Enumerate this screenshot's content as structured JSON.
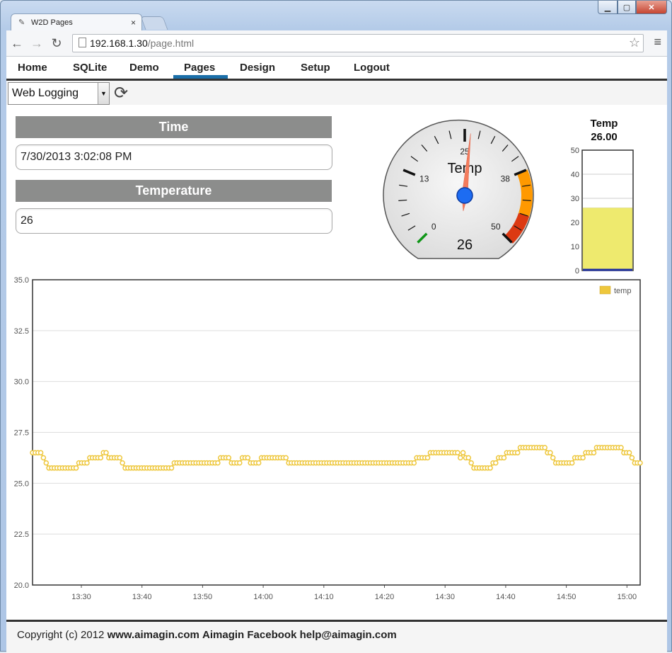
{
  "browser": {
    "tab_title": "W2D Pages",
    "tab_close": "×",
    "url_host": "192.168.1.30",
    "url_path": "/page.html",
    "icons": {
      "back": "arrow-left",
      "forward": "arrow-right",
      "reload": "reload",
      "star": "star",
      "menu": "menu"
    }
  },
  "nav": {
    "items": [
      "Home",
      "SQLite",
      "Demo",
      "Pages",
      "Design",
      "Setup",
      "Logout"
    ],
    "active": "Pages",
    "active_color": "#1a6ea8"
  },
  "toolbar": {
    "page_select": "Web Logging"
  },
  "panel": {
    "time_label": "Time",
    "time_value": "7/30/2013 3:02:08 PM",
    "temp_label": "Temperature",
    "temp_value": "26"
  },
  "gauge": {
    "title": "Temp",
    "value": 26,
    "value_text": "26",
    "min": 0,
    "max": 50,
    "tick_labels": [
      "0",
      "13",
      "25",
      "38",
      "50"
    ],
    "colors": {
      "orange": "#ff9900",
      "red": "#dc3912",
      "green": "#109618"
    }
  },
  "bar_gauge": {
    "title": "Temp",
    "value_text": "26.00",
    "value": 26,
    "ticks": [
      "50",
      "40",
      "30",
      "20",
      "10",
      "0"
    ],
    "fill_color": "#eeea6e"
  },
  "chart_data": {
    "type": "line",
    "legend": [
      "temp"
    ],
    "legend_position": "top-right",
    "series_color": "#eec73c",
    "ylim": [
      20,
      35
    ],
    "yticks": [
      "35.0",
      "32.5",
      "30.0",
      "27.5",
      "25.0",
      "22.5",
      "20.0"
    ],
    "xticks": [
      "13:30",
      "13:40",
      "13:50",
      "14:00",
      "14:10",
      "14:20",
      "14:30",
      "14:40",
      "14:50",
      "15:00"
    ],
    "grid": true,
    "series": [
      {
        "name": "temp",
        "values": [
          26.5,
          26.5,
          26.5,
          26.5,
          26.25,
          26.0,
          25.75,
          25.75,
          25.75,
          25.75,
          25.75,
          25.75,
          25.75,
          25.75,
          25.75,
          25.75,
          25.75,
          26.0,
          26.0,
          26.0,
          26.0,
          26.25,
          26.25,
          26.25,
          26.25,
          26.25,
          26.5,
          26.5,
          26.25,
          26.25,
          26.25,
          26.25,
          26.25,
          26.0,
          25.75,
          25.75,
          25.75,
          25.75,
          25.75,
          25.75,
          25.75,
          25.75,
          25.75,
          25.75,
          25.75,
          25.75,
          25.75,
          25.75,
          25.75,
          25.75,
          25.75,
          25.75,
          26.0,
          26.0,
          26.0,
          26.0,
          26.0,
          26.0,
          26.0,
          26.0,
          26.0,
          26.0,
          26.0,
          26.0,
          26.0,
          26.0,
          26.0,
          26.0,
          26.0,
          26.25,
          26.25,
          26.25,
          26.25,
          26.0,
          26.0,
          26.0,
          26.0,
          26.25,
          26.25,
          26.25,
          26.0,
          26.0,
          26.0,
          26.0,
          26.25,
          26.25,
          26.25,
          26.25,
          26.25,
          26.25,
          26.25,
          26.25,
          26.25,
          26.25,
          26.0,
          26.0,
          26.0,
          26.0,
          26.0,
          26.0,
          26.0,
          26.0,
          26.0,
          26.0,
          26.0,
          26.0,
          26.0,
          26.0,
          26.0,
          26.0,
          26.0,
          26.0,
          26.0,
          26.0,
          26.0,
          26.0,
          26.0,
          26.0,
          26.0,
          26.0,
          26.0,
          26.0,
          26.0,
          26.0,
          26.0,
          26.0,
          26.0,
          26.0,
          26.0,
          26.0,
          26.0,
          26.0,
          26.0,
          26.0,
          26.0,
          26.0,
          26.0,
          26.0,
          26.0,
          26.0,
          26.0,
          26.25,
          26.25,
          26.25,
          26.25,
          26.25,
          26.5,
          26.5,
          26.5,
          26.5,
          26.5,
          26.5,
          26.5,
          26.5,
          26.5,
          26.5,
          26.5,
          26.25,
          26.5,
          26.25,
          26.25,
          26.0,
          25.75,
          25.75,
          25.75,
          25.75,
          25.75,
          25.75,
          25.75,
          26.0,
          26.0,
          26.25,
          26.25,
          26.25,
          26.5,
          26.5,
          26.5,
          26.5,
          26.5,
          26.75,
          26.75,
          26.75,
          26.75,
          26.75,
          26.75,
          26.75,
          26.75,
          26.75,
          26.75,
          26.5,
          26.5,
          26.25,
          26.0,
          26.0,
          26.0,
          26.0,
          26.0,
          26.0,
          26.0,
          26.25,
          26.25,
          26.25,
          26.25,
          26.5,
          26.5,
          26.5,
          26.5,
          26.75,
          26.75,
          26.75,
          26.75,
          26.75,
          26.75,
          26.75,
          26.75,
          26.75,
          26.75,
          26.5,
          26.5,
          26.5,
          26.25,
          26.0,
          26.0,
          26.0
        ]
      }
    ]
  },
  "footer": {
    "copyright": "Copyright (c) 2012 ",
    "site": "www.aimagin.com",
    "facebook": "Aimagin Facebook",
    "email": "help@aimagin.com"
  }
}
